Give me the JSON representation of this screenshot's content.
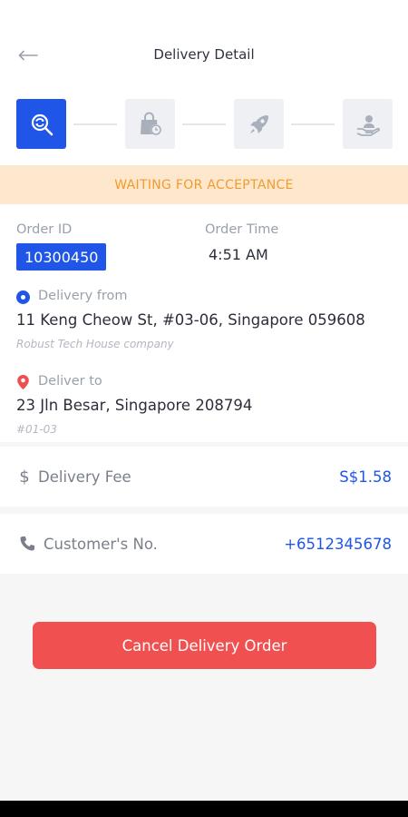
{
  "header": {
    "title": "Delivery Detail"
  },
  "steps": [
    {
      "name": "searching",
      "active": true
    },
    {
      "name": "pending-pickup",
      "active": false
    },
    {
      "name": "on-the-way",
      "active": false
    },
    {
      "name": "delivered",
      "active": false
    }
  ],
  "status": {
    "text": "WAITING FOR ACCEPTANCE"
  },
  "order": {
    "id_label": "Order ID",
    "id": "10300450",
    "time_label": "Order Time",
    "time": "4:51 AM"
  },
  "from": {
    "label": "Delivery from",
    "address": "11 Keng Cheow St, #03-06, Singapore 059608",
    "note": "Robust Tech House company"
  },
  "to": {
    "label": "Deliver to",
    "address": "23 Jln Besar, Singapore 208794",
    "note": "#01-03"
  },
  "fee": {
    "label": "Delivery Fee",
    "value": "S$1.58"
  },
  "customer": {
    "label": "Customer's No.",
    "value": "+6512345678"
  },
  "cancel_button": {
    "label": "Cancel Delivery Order"
  },
  "colors": {
    "primary": "#1f56e8",
    "danger": "#f0504f",
    "banner_bg": "#fde8cd",
    "banner_text": "#f39a2e"
  }
}
